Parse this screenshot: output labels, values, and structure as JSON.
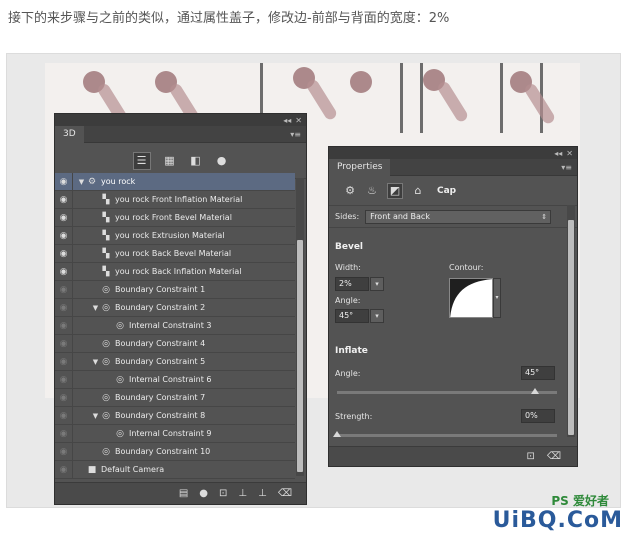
{
  "caption": "接下的来步骤与之前的类似，通过属性盖子，修改边-前部与背面的宽度：2%",
  "panel3d": {
    "tab_label": "3D",
    "collapse_icon": "double-chevron-icon",
    "menu_icon": "panel-menu-icon",
    "filters": [
      {
        "name": "scene-filter",
        "glyph": "☰"
      },
      {
        "name": "mesh-filter",
        "glyph": "▦"
      },
      {
        "name": "material-filter",
        "glyph": "◧"
      },
      {
        "name": "light-filter",
        "glyph": "●"
      }
    ],
    "rows": [
      {
        "label": "you rock",
        "level": 0,
        "tri": "▼",
        "icon": "⚙",
        "visible": true,
        "selected": true
      },
      {
        "label": "you rock Front Inflation Material",
        "level": 1,
        "tri": "",
        "icon": "▚",
        "visible": true,
        "selected": false
      },
      {
        "label": "you rock Front Bevel Material",
        "level": 1,
        "tri": "",
        "icon": "▚",
        "visible": true,
        "selected": false
      },
      {
        "label": "you rock Extrusion Material",
        "level": 1,
        "tri": "",
        "icon": "▚",
        "visible": true,
        "selected": false
      },
      {
        "label": "you rock Back Bevel Material",
        "level": 1,
        "tri": "",
        "icon": "▚",
        "visible": true,
        "selected": false
      },
      {
        "label": "you rock Back Inflation Material",
        "level": 1,
        "tri": "",
        "icon": "▚",
        "visible": true,
        "selected": false
      },
      {
        "label": "Boundary Constraint 1",
        "level": 1,
        "tri": "",
        "icon": "◎",
        "visible": false,
        "selected": false
      },
      {
        "label": "Boundary Constraint 2",
        "level": 1,
        "tri": "▼",
        "icon": "◎",
        "visible": false,
        "selected": false
      },
      {
        "label": "Internal Constraint 3",
        "level": 2,
        "tri": "",
        "icon": "◎",
        "visible": false,
        "selected": false
      },
      {
        "label": "Boundary Constraint 4",
        "level": 1,
        "tri": "",
        "icon": "◎",
        "visible": false,
        "selected": false
      },
      {
        "label": "Boundary Constraint 5",
        "level": 1,
        "tri": "▼",
        "icon": "◎",
        "visible": false,
        "selected": false
      },
      {
        "label": "Internal Constraint 6",
        "level": 2,
        "tri": "",
        "icon": "◎",
        "visible": false,
        "selected": false
      },
      {
        "label": "Boundary Constraint 7",
        "level": 1,
        "tri": "",
        "icon": "◎",
        "visible": false,
        "selected": false
      },
      {
        "label": "Boundary Constraint 8",
        "level": 1,
        "tri": "▼",
        "icon": "◎",
        "visible": false,
        "selected": false
      },
      {
        "label": "Internal Constraint 9",
        "level": 2,
        "tri": "",
        "icon": "◎",
        "visible": false,
        "selected": false
      },
      {
        "label": "Boundary Constraint 10",
        "level": 1,
        "tri": "",
        "icon": "◎",
        "visible": false,
        "selected": false
      },
      {
        "label": "Default Camera",
        "level": 0,
        "tri": "",
        "icon": "■",
        "visible": false,
        "selected": false
      }
    ],
    "bottom_icons": [
      "▤",
      "●",
      "⊡",
      "⊥",
      "⊥",
      "🗑"
    ]
  },
  "properties": {
    "tab_label": "Properties",
    "mode_label": "Cap",
    "sides_label": "Sides:",
    "sides_value": "Front and Back",
    "bevel_title": "Bevel",
    "width_label": "Width:",
    "width_value": "2%",
    "contour_label": "Contour:",
    "bevel_angle_label": "Angle:",
    "bevel_angle_value": "45°",
    "inflate_title": "Inflate",
    "inflate_angle_label": "Angle:",
    "inflate_angle_value": "45°",
    "strength_label": "Strength:",
    "strength_value": "0%",
    "inflate_angle_fraction": 0.9,
    "strength_fraction": 0.0
  },
  "watermark": {
    "ps_text": "PS 爱好者",
    "site_text": "UiBQ.CoM"
  }
}
